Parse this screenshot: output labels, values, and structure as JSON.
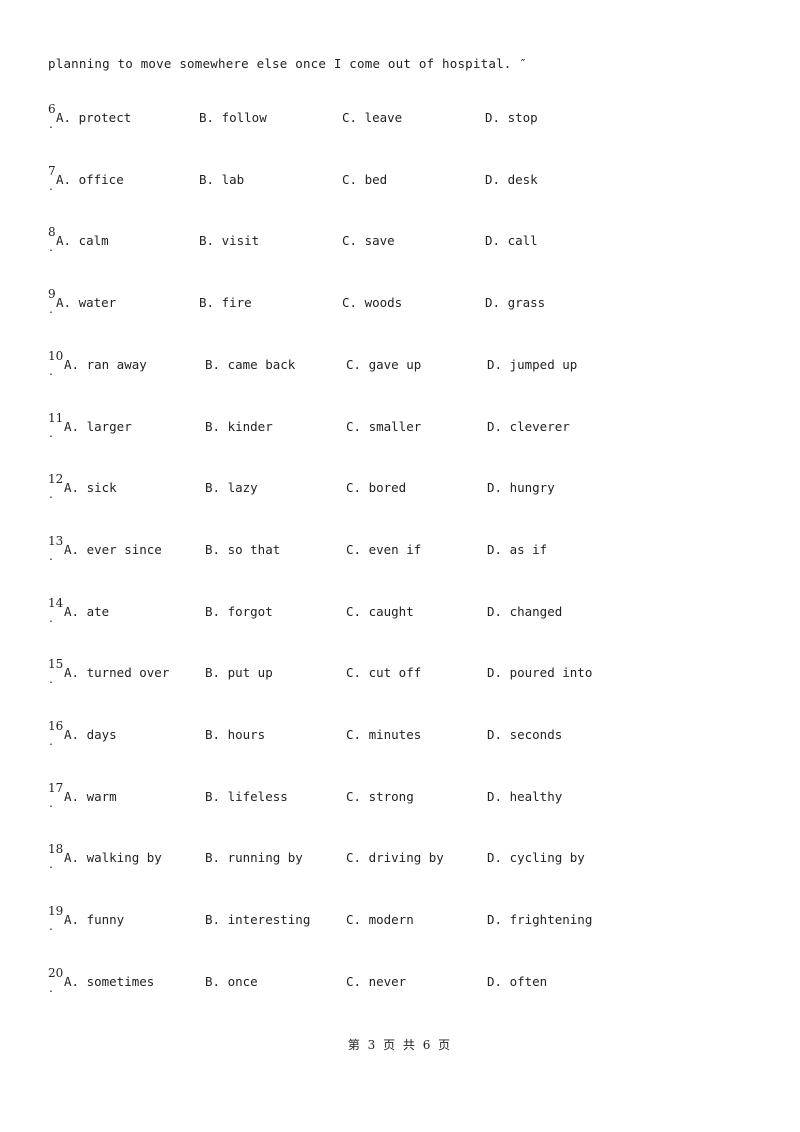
{
  "intro_text": "planning to move somewhere else once I come out of hospital. ″",
  "questions": [
    {
      "num": "6",
      "A": "A. protect",
      "B": "B. follow",
      "C": "C. leave",
      "D": "D. stop"
    },
    {
      "num": "7",
      "A": "A. office",
      "B": "B. lab",
      "C": "C. bed",
      "D": "D. desk"
    },
    {
      "num": "8",
      "A": "A. calm",
      "B": "B. visit",
      "C": "C. save",
      "D": "D. call"
    },
    {
      "num": "9",
      "A": "A. water",
      "B": "B. fire",
      "C": "C. woods",
      "D": "D. grass"
    },
    {
      "num": "10",
      "A": "A. ran away",
      "B": "B. came back",
      "C": "C. gave up",
      "D": "D. jumped up"
    },
    {
      "num": "11",
      "A": "A. larger",
      "B": "B. kinder",
      "C": "C. smaller",
      "D": "D. cleverer"
    },
    {
      "num": "12",
      "A": "A. sick",
      "B": "B. lazy",
      "C": "C. bored",
      "D": "D. hungry"
    },
    {
      "num": "13",
      "A": "A. ever since",
      "B": "B. so that",
      "C": "C. even if",
      "D": "D. as if"
    },
    {
      "num": "14",
      "A": "A. ate",
      "B": "B. forgot",
      "C": "C. caught",
      "D": "D. changed"
    },
    {
      "num": "15",
      "A": "A. turned over",
      "B": "B. put up",
      "C": "C. cut off",
      "D": "D. poured into"
    },
    {
      "num": "16",
      "A": "A. days",
      "B": "B. hours",
      "C": "C. minutes",
      "D": "D. seconds"
    },
    {
      "num": "17",
      "A": "A. warm",
      "B": "B. lifeless",
      "C": "C. strong",
      "D": "D. healthy"
    },
    {
      "num": "18",
      "A": "A. walking by",
      "B": "B. running by",
      "C": "C. driving by",
      "D": "D. cycling by"
    },
    {
      "num": "19",
      "A": "A. funny",
      "B": "B. interesting",
      "C": "C. modern",
      "D": "D. frightening"
    },
    {
      "num": "20",
      "A": "A. sometimes",
      "B": "B. once",
      "C": "C. never",
      "D": "D. often"
    }
  ],
  "dot": ".",
  "footer": "第 3 页 共 6 页"
}
